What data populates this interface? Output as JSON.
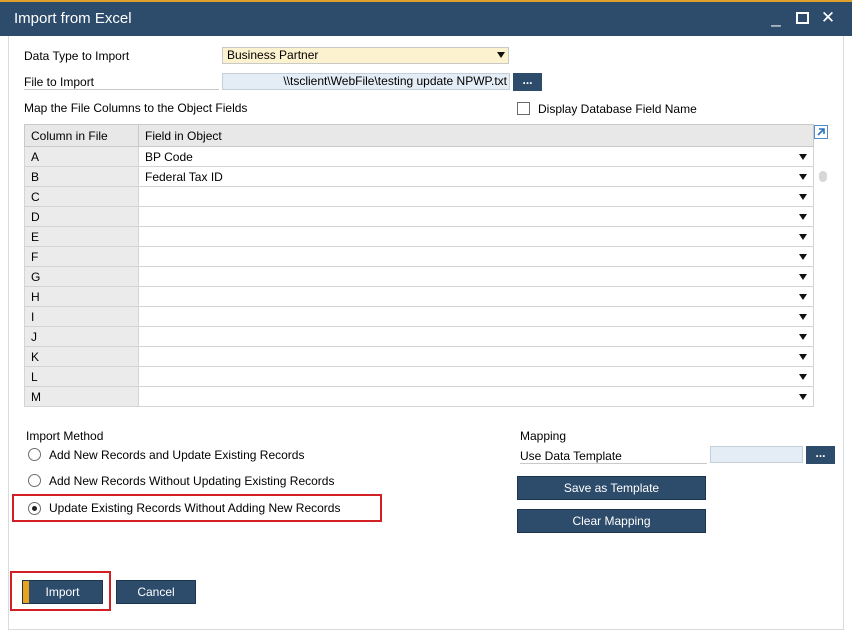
{
  "window": {
    "title": "Import from Excel",
    "minimize_glyph": "_",
    "close_glyph": "✕"
  },
  "form": {
    "data_type_label": "Data Type to Import",
    "data_type_value": "Business Partner",
    "file_label": "File to Import",
    "file_value": "\\\\tsclient\\WebFile\\testing update NPWP.txt",
    "browse_label": "...",
    "map_label": "Map the File Columns to the Object Fields",
    "display_db_field_label": "Display Database Field Name",
    "display_db_field_checked": false
  },
  "grid": {
    "headers": [
      "Column in File",
      "Field in Object"
    ],
    "rows": [
      {
        "column": "A",
        "field": "BP Code"
      },
      {
        "column": "B",
        "field": "Federal Tax ID"
      },
      {
        "column": "C",
        "field": ""
      },
      {
        "column": "D",
        "field": ""
      },
      {
        "column": "E",
        "field": ""
      },
      {
        "column": "F",
        "field": ""
      },
      {
        "column": "G",
        "field": ""
      },
      {
        "column": "H",
        "field": ""
      },
      {
        "column": "I",
        "field": ""
      },
      {
        "column": "J",
        "field": ""
      },
      {
        "column": "K",
        "field": ""
      },
      {
        "column": "L",
        "field": ""
      },
      {
        "column": "M",
        "field": ""
      }
    ]
  },
  "import_method": {
    "label": "Import Method",
    "options": [
      {
        "label": "Add New Records and Update Existing Records",
        "selected": false
      },
      {
        "label": "Add New Records Without Updating Existing Records",
        "selected": false
      },
      {
        "label": "Update Existing Records Without Adding New Records",
        "selected": true
      }
    ]
  },
  "mapping": {
    "label": "Mapping",
    "template_label": "Use Data Template",
    "template_value": "",
    "browse_label": "...",
    "save_template_label": "Save as Template",
    "clear_mapping_label": "Clear Mapping"
  },
  "footer": {
    "import_label": "Import",
    "cancel_label": "Cancel"
  },
  "colors": {
    "titlebar": "#2d4b6b",
    "button": "#2d4b6b",
    "accent": "#e8a21e",
    "highlight": "#d21f26",
    "combo_bg": "#fdf2cf",
    "field_bg": "#e4ecf5"
  }
}
